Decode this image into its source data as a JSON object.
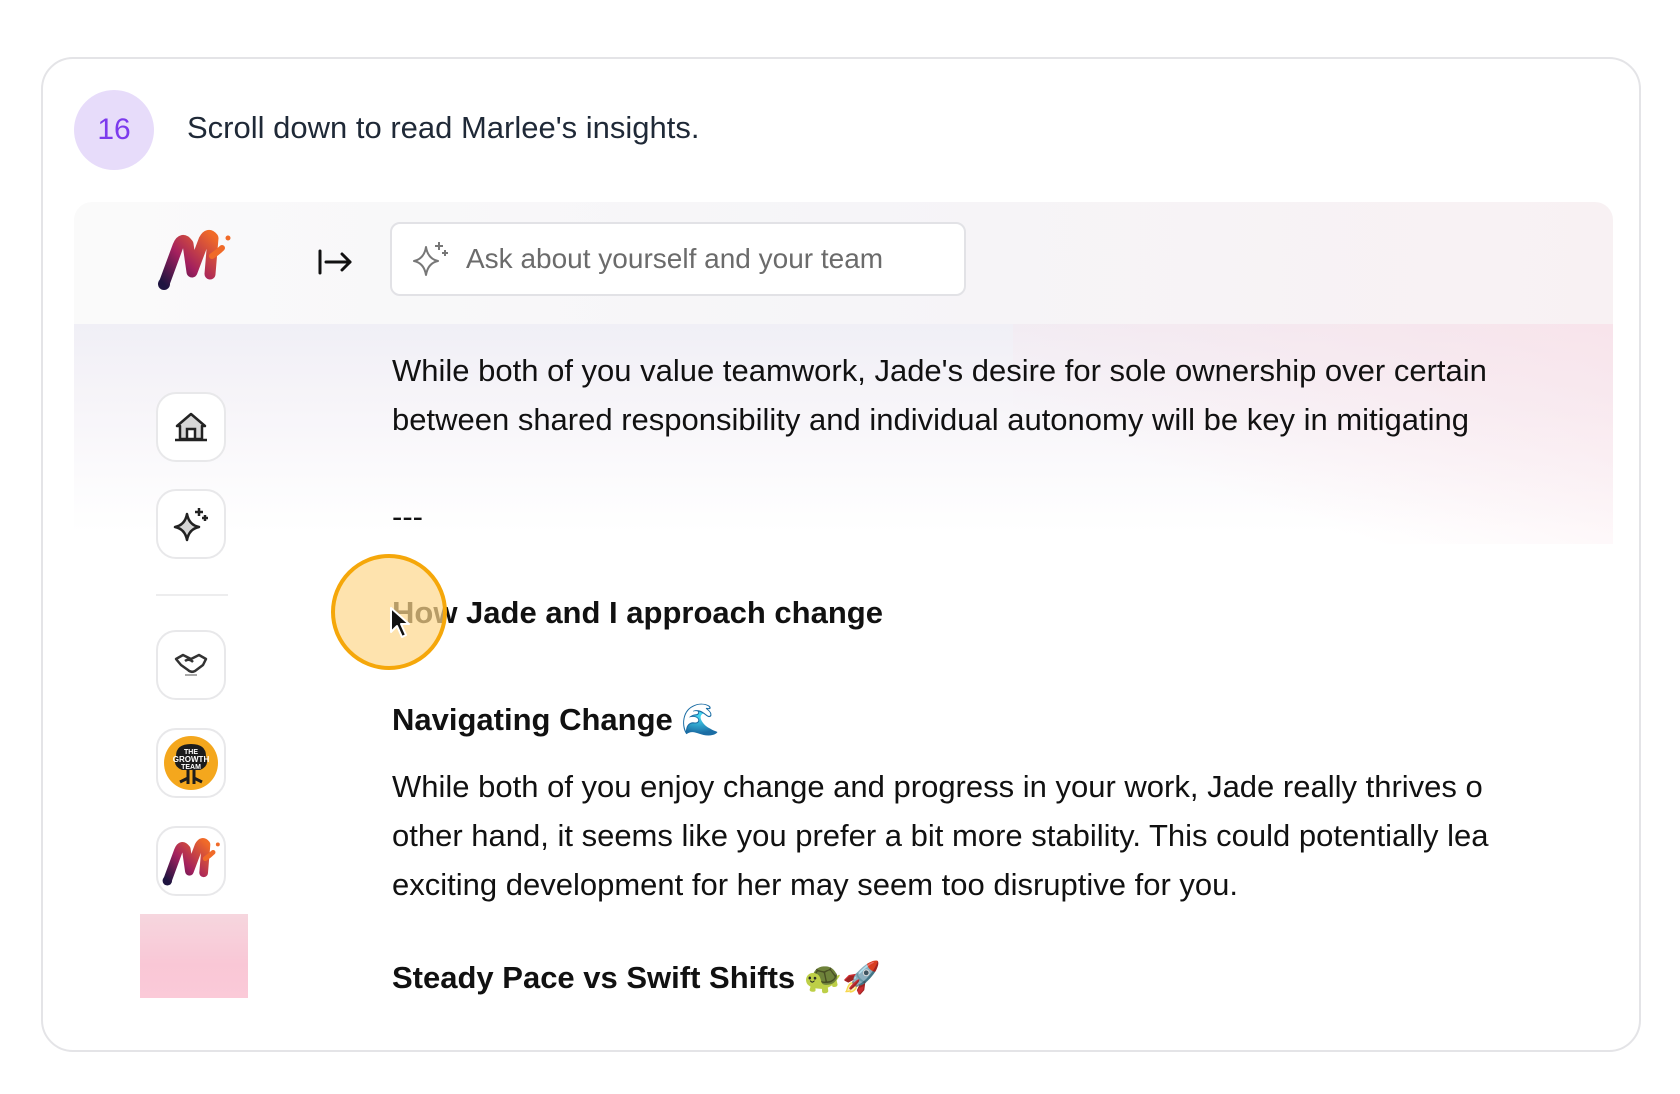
{
  "step": {
    "number": "16",
    "instruction": "Scroll down to read Marlee's insights."
  },
  "app": {
    "brand": "Marlee",
    "search": {
      "placeholder": "Ask about yourself and your team",
      "value": ""
    },
    "icons": {
      "collapse": "sidebar-expand-icon",
      "search": "sparkle-icon"
    },
    "sidebar": {
      "items": [
        {
          "name": "home",
          "icon": "home-icon"
        },
        {
          "name": "ask-ai",
          "icon": "sparkle-icon"
        },
        {
          "name": "collaboration",
          "icon": "handshake-icon"
        },
        {
          "name": "the-growth-team",
          "icon": "team-logo-icon",
          "label": "THE GROWTH TEAM"
        },
        {
          "name": "marlee",
          "icon": "marlee-logo-icon"
        }
      ]
    },
    "content": {
      "para1_line1": "While both of you value teamwork, Jade's desire for sole ownership over certain",
      "para1_line2": "between shared responsibility and individual autonomy will be key in mitigating",
      "divider": "---",
      "section_heading": "How Jade and I approach change",
      "sub1_title": "Navigating Change 🌊",
      "para2_line1": "While both of you enjoy change and progress in your work, Jade really thrives o",
      "para2_line2": "other hand, it seems like you prefer a bit more stability. This could potentially lea",
      "para2_line3": "exciting development for her may seem too disruptive for you.",
      "sub2_title": "Steady Pace vs Swift Shifts 🐢🚀"
    }
  },
  "colors": {
    "badge_bg": "#e7dcfa",
    "badge_text": "#7c3aed",
    "highlight_ring": "#f5a70a"
  }
}
